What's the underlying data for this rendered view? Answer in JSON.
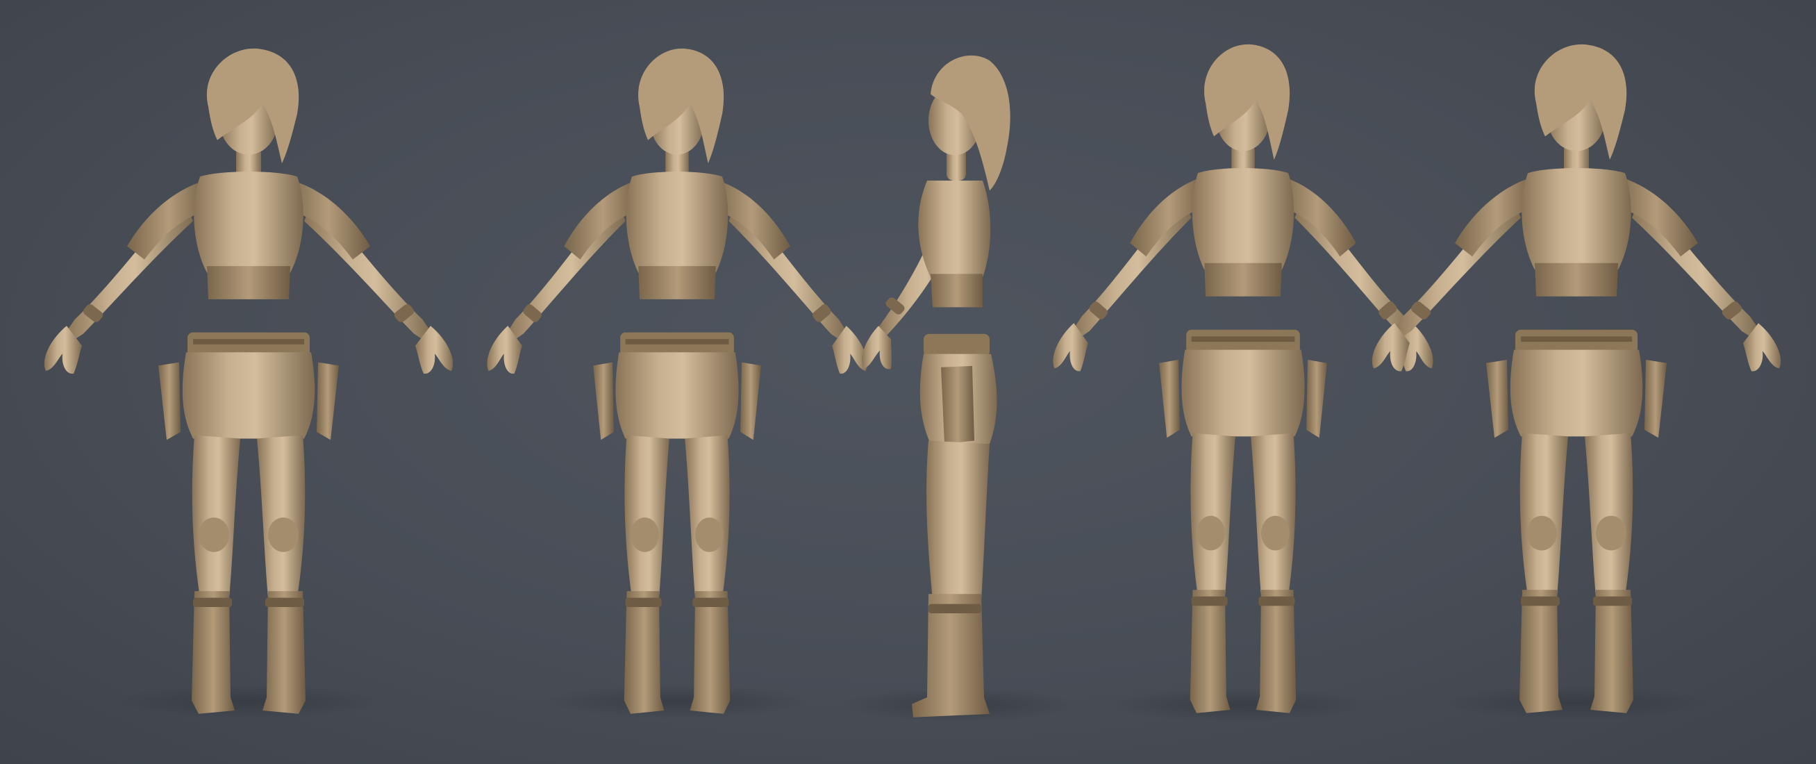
{
  "scene": {
    "background_color": "#464b54",
    "clay_color": "#b8a182",
    "clay_shadow_color": "#8a7458",
    "clay_highlight_color": "#d8c4a6",
    "views": [
      {
        "name": "front-view"
      },
      {
        "name": "three-quarter-front-view"
      },
      {
        "name": "side-view"
      },
      {
        "name": "three-quarter-back-view"
      },
      {
        "name": "back-view"
      }
    ]
  }
}
